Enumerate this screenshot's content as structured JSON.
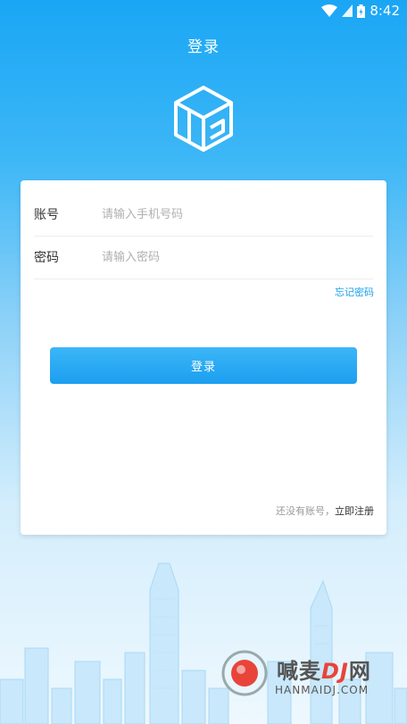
{
  "status_bar": {
    "time": "8:42"
  },
  "header": {
    "title": "登录"
  },
  "form": {
    "account_label": "账号",
    "account_placeholder": "请输入手机号码",
    "password_label": "密码",
    "password_placeholder": "请输入密码",
    "forgot_label": "忘记密码",
    "login_label": "登录",
    "register_prompt": "还没有账号，",
    "register_link": "立即注册"
  },
  "watermark": {
    "brand_cn_a": "喊麦",
    "brand_cn_b": "DJ",
    "brand_cn_c": "网",
    "brand_en": "HANMAIDJ.COM"
  },
  "colors": {
    "primary": "#1aa1ee",
    "background_top": "#1aa6f5"
  },
  "icons": [
    "wifi-icon",
    "signal-icon",
    "battery-icon",
    "cube-logo-icon"
  ]
}
